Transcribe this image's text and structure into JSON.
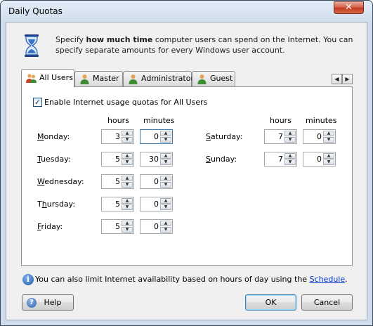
{
  "window": {
    "title": "Daily Quotas",
    "close_glyph": "✕"
  },
  "intro": {
    "pre": "Specify ",
    "bold": "how much time",
    "post": " computer users can spend on the Internet. You can specify separate amounts for every Windows user account."
  },
  "tabs": [
    {
      "label": "All Users",
      "icon": "users-group-icon",
      "active": true
    },
    {
      "label": "Master",
      "icon": "user-icon"
    },
    {
      "label": "Administrator",
      "icon": "user-icon"
    },
    {
      "label": "Guest",
      "icon": "user-icon"
    }
  ],
  "tab_scroll": {
    "left": "◀",
    "right": "▶"
  },
  "enable": {
    "checked": true,
    "label": "Enable Internet usage quotas for All Users",
    "check_glyph": "✓"
  },
  "columns": {
    "hours": "hours",
    "minutes": "minutes"
  },
  "days": {
    "monday": {
      "label": "Monday:",
      "hotkey": "M",
      "rest": "onday:",
      "hours": "3",
      "minutes": "0"
    },
    "tuesday": {
      "label": "Tuesday:",
      "hotkey": "T",
      "rest": "uesday:",
      "hours": "5",
      "minutes": "30"
    },
    "wednesday": {
      "label": "Wednesday:",
      "hotkey": "W",
      "rest": "ednesday:",
      "hours": "5",
      "minutes": "0"
    },
    "thursday": {
      "label": "Thursday:",
      "hotkey": "h",
      "pre": "T",
      "rest": "ursday:",
      "hours": "5",
      "minutes": "0"
    },
    "friday": {
      "label": "Friday:",
      "hotkey": "F",
      "rest": "riday:",
      "hours": "5",
      "minutes": "0"
    },
    "saturday": {
      "label": "Saturday:",
      "hotkey": "S",
      "rest": "aturday:",
      "hours": "7",
      "minutes": "0"
    },
    "sunday": {
      "label": "Sunday:",
      "hotkey": "S",
      "rest": "unday:",
      "hours": "7",
      "minutes": "0"
    }
  },
  "spin": {
    "up": "▲",
    "down": "▼"
  },
  "footer": {
    "info_glyph": "i",
    "info_text": "You can also limit Internet availability based on hours of day using the ",
    "link": "Schedule",
    "after_link": "."
  },
  "buttons": {
    "help": "Help",
    "help_glyph": "?",
    "ok": "OK",
    "cancel": "Cancel"
  }
}
